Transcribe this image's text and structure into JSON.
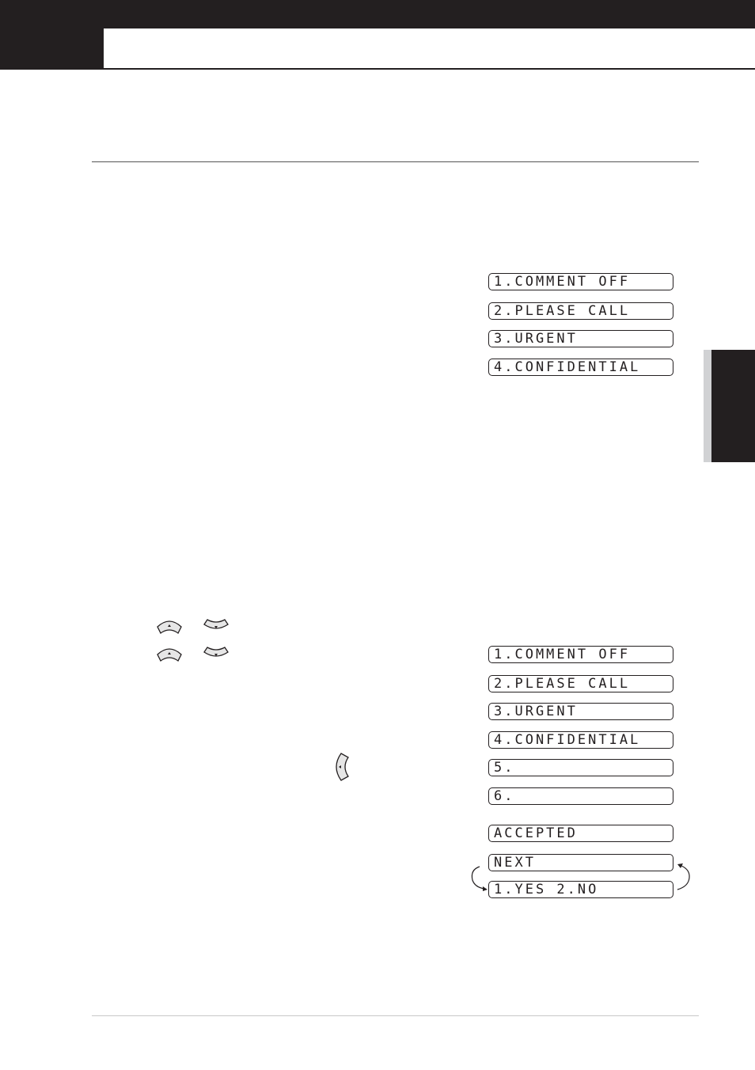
{
  "page": {
    "colors": {
      "dark": "#231f20",
      "tab_shade": "#d1d2d4",
      "key_fill": "#e6e6e6"
    }
  },
  "lcd_group_1": {
    "lines": [
      "1.COMMENT OFF",
      "2.PLEASE CALL",
      "3.URGENT",
      "4.CONFIDENTIAL"
    ]
  },
  "lcd_group_2": {
    "lines": [
      "1.COMMENT OFF",
      "2.PLEASE CALL",
      "3.URGENT",
      "4.CONFIDENTIAL",
      "5.",
      "6."
    ]
  },
  "lcd_group_3": {
    "accepted": "ACCEPTED",
    "next": "NEXT",
    "yes_no": "1.YES 2.NO"
  },
  "icons": {
    "up_key": "up-arrow-key-icon",
    "down_key": "down-arrow-key-icon",
    "left_key": "left-arrow-key-icon",
    "cycle_arrows": "cycle-arrow-icon"
  }
}
